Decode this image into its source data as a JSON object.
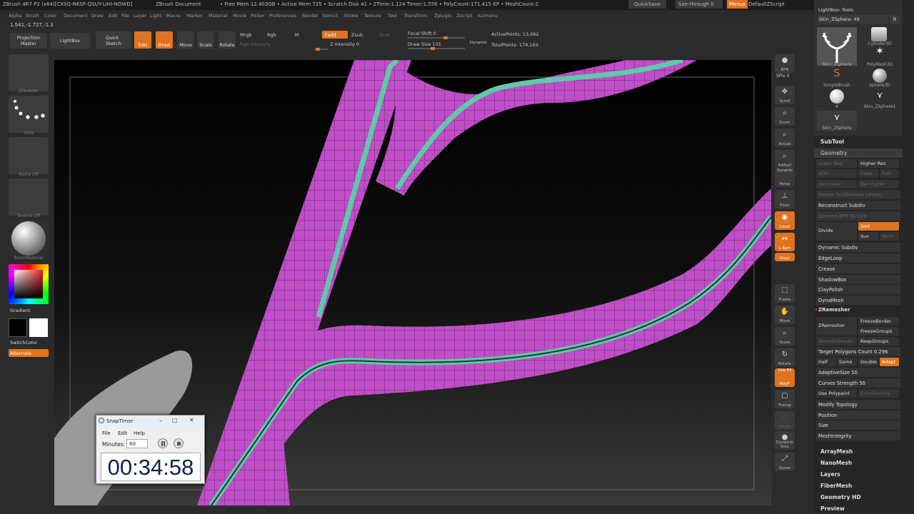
{
  "title": {
    "app": "ZBrush 4R7 P2 (x64)[CXSQ-NKSF-QSUY-LIHI-NOWD]",
    "document": "ZBrush Document",
    "stats": "• Free Mem 12.403GB • Active Mem 725 • Scratch Disk 41 • ZTime›1.124 Timer›1.556 • PolyCount›171.415 KP • MeshCount›2",
    "quicksave": "QuickSave",
    "seethrough": "See-through  0",
    "menus": "Menus",
    "script": "DefaultZScript"
  },
  "menu": [
    "Alpha",
    "Brush",
    "Color",
    "Document",
    "Draw",
    "Edit",
    "File",
    "Layer",
    "Light",
    "Macro",
    "Marker",
    "Material",
    "Movie",
    "Picker",
    "Preferences",
    "Render",
    "Stencil",
    "Stroke",
    "Texture",
    "Tool",
    "Transform",
    "Zplugin",
    "Zscript",
    "luzmenu"
  ],
  "coords": "1.541,-1.727,-1.3",
  "toolbar": {
    "projection_master": "Projection Master",
    "lightbox": "LightBox",
    "quick_sketch": "Quick Sketch",
    "edit": "Edit",
    "draw": "Draw",
    "move": "Move",
    "scale": "Scale",
    "rotate": "Rotate",
    "mrgb": "Mrgb",
    "rgb": "Rgb",
    "m": "M",
    "rgb_intensity": "Rgb Intensity",
    "zadd": "Zadd",
    "zsub": "Zsub",
    "zcut": "Zcut",
    "z_intensity": "Z Intensity 0",
    "focal_shift": "Focal Shift 0",
    "draw_size": "Draw Size 131",
    "dynamic": "Dynamic",
    "active_points": "ActivePoints: 13,062",
    "total_points": "TotalPoints: 174,163"
  },
  "left_shelf": {
    "zmodeler": "ZModeler",
    "dots": "Dots",
    "alpha_off": "Alpha Off",
    "texture_off": "Texture Off",
    "basic_material": "BasicMaterial",
    "gradient": "Gradient",
    "switch_color": "SwitchColor",
    "alternate": "Alternate"
  },
  "right_shelf": {
    "bpr": "BPR",
    "spix": "SPix 3",
    "scroll": "Scroll",
    "zoom": "Zoom",
    "actual": "Actual",
    "aahalf": "AAHalf",
    "dynamic": "Dynamic",
    "persp": "Persp",
    "floor": "Floor",
    "local": "Local",
    "lsym": "L.Sym",
    "xyz": "Qxyz",
    "frame": "Frame",
    "move": "Move",
    "scale": "Scale",
    "rotate": "Rotate",
    "line_fill": "Line Fill",
    "polyf": "PolyF",
    "transp": "Transp",
    "ghost": "Ghost",
    "solo": "Dynamic Solo",
    "xpose": "Xpose"
  },
  "tools": {
    "header": "LightBox› Tools",
    "current": "Skin_ZSphere. 49",
    "r": "R",
    "items": [
      "Skin_ZSphere",
      "Cylinder3D",
      "PolyMesh3D",
      "SimpleBrush",
      "Sphere3D",
      "Skin_ZSphere1",
      "Skin_ZSphere"
    ],
    "count": "4"
  },
  "palette": {
    "subtool": "SubTool",
    "geometry": "Geometry",
    "lower_res": "Lower Res",
    "higher_res": "Higher Res",
    "sdiv": "SDiv",
    "cage": "Cage",
    "rstr": "Rstr",
    "del_lower": "Del Lower",
    "del_higher": "Del Higher",
    "freeze_subdiv": "Freeze SubDivision Levels",
    "reconstruct_subdiv": "Reconstruct Subdiv",
    "convert_bpr": "Convert BPR To Geo",
    "divide": "Divide",
    "smt": "Smt",
    "suv": "Suv",
    "reuv": "ReUV",
    "dynamic_subdiv": "Dynamic Subdiv",
    "edgeloop": "EdgeLoop",
    "crease": "Crease",
    "shadowbox": "ShadowBox",
    "claypolish": "ClayPolish",
    "dynamesh": "DynaMesh",
    "zremesher_hdr": "ZRemesher",
    "zremesher": "ZRemesher",
    "freeze_border": "FreezeBorder",
    "freeze_groups": "FreezeGroups",
    "smooth_groups": "SmoothGroups",
    "keep_groups": "KeepGroups",
    "target_polygons": "Target Polygons Count 0.296",
    "half": "Half",
    "same": "Same",
    "double": "Double",
    "adapt": "Adapt",
    "adaptive_size": "AdaptiveSize 50",
    "curves_strength": "Curves Strength 50",
    "use_polypaint": "Use Polypaint",
    "color_density": "ColorDensity",
    "modify_topology": "Modify Topology",
    "position": "Position",
    "size": "Size",
    "mesh_integrity": "MeshIntegrity",
    "arraymesh": "ArrayMesh",
    "nanomesh": "NanoMesh",
    "layers": "Layers",
    "fibermesh": "FiberMesh",
    "geometry_hd": "Geometry HD",
    "preview": "Preview"
  },
  "snaptimer": {
    "title": "SnapTimer",
    "menu_file": "File",
    "menu_edit": "Edit",
    "menu_help": "Help",
    "minutes_label": "Minutes:",
    "minutes_value": "60",
    "time": "00:34:58"
  },
  "colors": {
    "accent": "#e07320",
    "mesh_pink": "#c04ec8",
    "mesh_teal": "#5fc9a8"
  }
}
